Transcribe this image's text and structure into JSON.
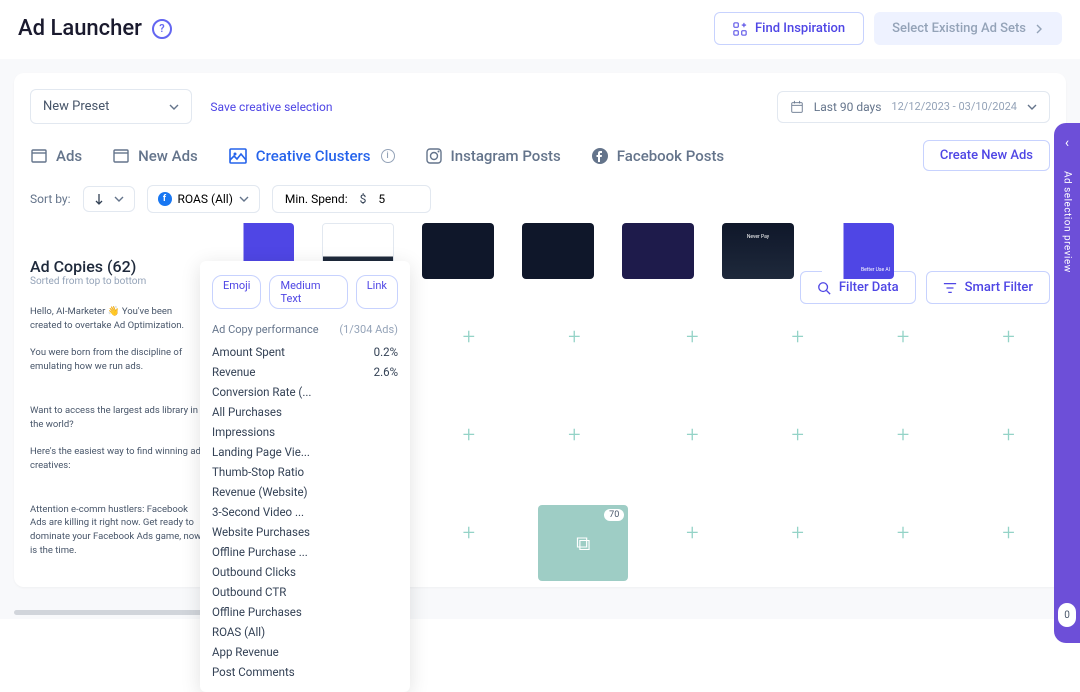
{
  "header": {
    "title": "Ad Launcher",
    "find_inspiration": "Find Inspiration",
    "select_existing": "Select Existing Ad Sets"
  },
  "controls": {
    "preset": "New Preset",
    "save_selection": "Save creative selection",
    "date_label": "Last 90 days",
    "date_range": "12/12/2023 - 03/10/2024"
  },
  "tabs": {
    "ads": "Ads",
    "new_ads": "New Ads",
    "creative_clusters": "Creative Clusters",
    "instagram": "Instagram Posts",
    "facebook": "Facebook Posts",
    "create_new": "Create New Ads"
  },
  "filters": {
    "sort_by": "Sort by:",
    "roas": "ROAS (All)",
    "min_spend_label": "Min. Spend:",
    "min_spend_currency": "$",
    "min_spend_value": "5",
    "filter_data": "Filter Data",
    "smart_filter": "Smart Filter"
  },
  "dropdown": {
    "tags": [
      "Emoji",
      "Medium Text",
      "Link"
    ],
    "perf_label": "Ad Copy performance",
    "perf_count": "(1/304 Ads)",
    "metrics": [
      {
        "name": "Amount Spent",
        "value": "0.2%"
      },
      {
        "name": "Revenue",
        "value": "2.6%"
      },
      {
        "name": "Conversion Rate (...",
        "value": ""
      },
      {
        "name": "All Purchases",
        "value": ""
      },
      {
        "name": "Impressions",
        "value": ""
      },
      {
        "name": "Landing Page Vie...",
        "value": ""
      },
      {
        "name": "Thumb-Stop Ratio",
        "value": ""
      },
      {
        "name": "Revenue (Website)",
        "value": ""
      },
      {
        "name": "3-Second Video ...",
        "value": ""
      },
      {
        "name": "Website Purchases",
        "value": ""
      },
      {
        "name": "Offline Purchase ...",
        "value": ""
      },
      {
        "name": "Outbound Clicks",
        "value": ""
      },
      {
        "name": "Outbound CTR",
        "value": ""
      },
      {
        "name": "Offline Purchases",
        "value": ""
      },
      {
        "name": "ROAS (All)",
        "value": ""
      },
      {
        "name": "App Revenue",
        "value": ""
      },
      {
        "name": "Post Comments",
        "value": ""
      }
    ]
  },
  "copies": {
    "title": "Ad Copies (62)",
    "subtitle": "Sorted from top to bottom",
    "items": [
      "Hello, AI-Marketer 👋 You've been created to overtake Ad Optimization.\n\nYou were born from the discipline of emulating how we run ads.",
      "Want to access the largest ads library in the world?\n\nHere's the easiest way to find winning ad creatives:",
      "Attention e-comm hustlers: Facebook Ads are killing it right now. Get ready to dominate your Facebook Ads game, now is the time."
    ]
  },
  "grid": {
    "upload_badge": "70"
  },
  "sidepanel": {
    "label": "Ad selection preview",
    "count": "0"
  }
}
